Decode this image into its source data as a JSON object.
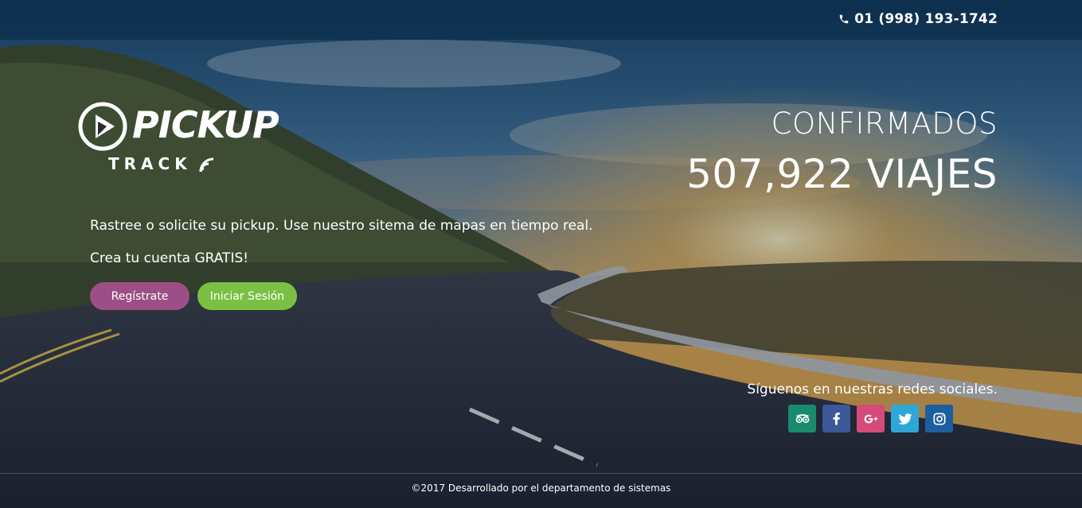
{
  "header": {
    "phone": "01 (998) 193-1742",
    "phone_icon": "phone-icon"
  },
  "brand": {
    "name_top": "PICKUP",
    "name_bottom": "TRACK",
    "logo_icon": "play-circle-icon"
  },
  "hero": {
    "tagline": "Rastree o solicite su pickup. Use nuestro sitema de mapas en tiempo real.",
    "promo": "Crea tu cuenta GRATIS!",
    "register_label": "Regístrate",
    "login_label": "Iniciar Sesión"
  },
  "stats": {
    "label": "CONFIRMADOS",
    "value": "507,922 VIAJES"
  },
  "social": {
    "title": "Síguenos en nuestras redes sociales.",
    "items": [
      {
        "icon": "tripadvisor-icon",
        "color": "#1a8a6e"
      },
      {
        "icon": "facebook-icon",
        "color": "#3b5998"
      },
      {
        "icon": "google-plus-icon",
        "color": "#d64a7a"
      },
      {
        "icon": "twitter-icon",
        "color": "#2ea7d8"
      },
      {
        "icon": "instagram-icon",
        "color": "#1c5fa1"
      }
    ]
  },
  "footer": {
    "text": "©2017 Desarrollado por el departamento de sistemas"
  },
  "colors": {
    "register": "#9c4f86",
    "login": "#79c043",
    "topbar": "#0a2846"
  }
}
